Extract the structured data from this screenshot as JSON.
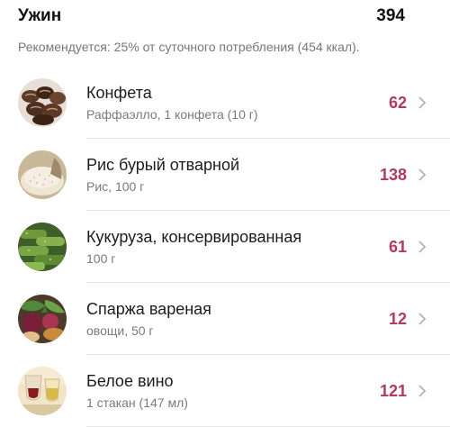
{
  "meal": {
    "title": "Ужин",
    "total_kcal": "394",
    "recommendation": "Рекомендуется: 25% от суточного потребления (454 ккал)."
  },
  "items": [
    {
      "name": "Конфета",
      "detail": "Раффаэлло, 1 конфета (10 г)",
      "kcal": "62",
      "icon": "candy-image"
    },
    {
      "name": "Рис бурый отварной",
      "detail": "Рис, 100 г",
      "kcal": "138",
      "icon": "rice-image"
    },
    {
      "name": "Кукуруза, консервированная",
      "detail": "100 г",
      "kcal": "61",
      "icon": "cucumber-image"
    },
    {
      "name": "Спаржа вареная",
      "detail": "овощи, 50 г",
      "kcal": "12",
      "icon": "vegetables-image"
    },
    {
      "name": "Белое вино",
      "detail": "1 стакан (147 мл)",
      "kcal": "121",
      "icon": "wine-image"
    }
  ],
  "colors": {
    "kcal_accent": "#b5395f",
    "divider": "#e3e3e3",
    "muted_text": "#7a7a7a"
  }
}
